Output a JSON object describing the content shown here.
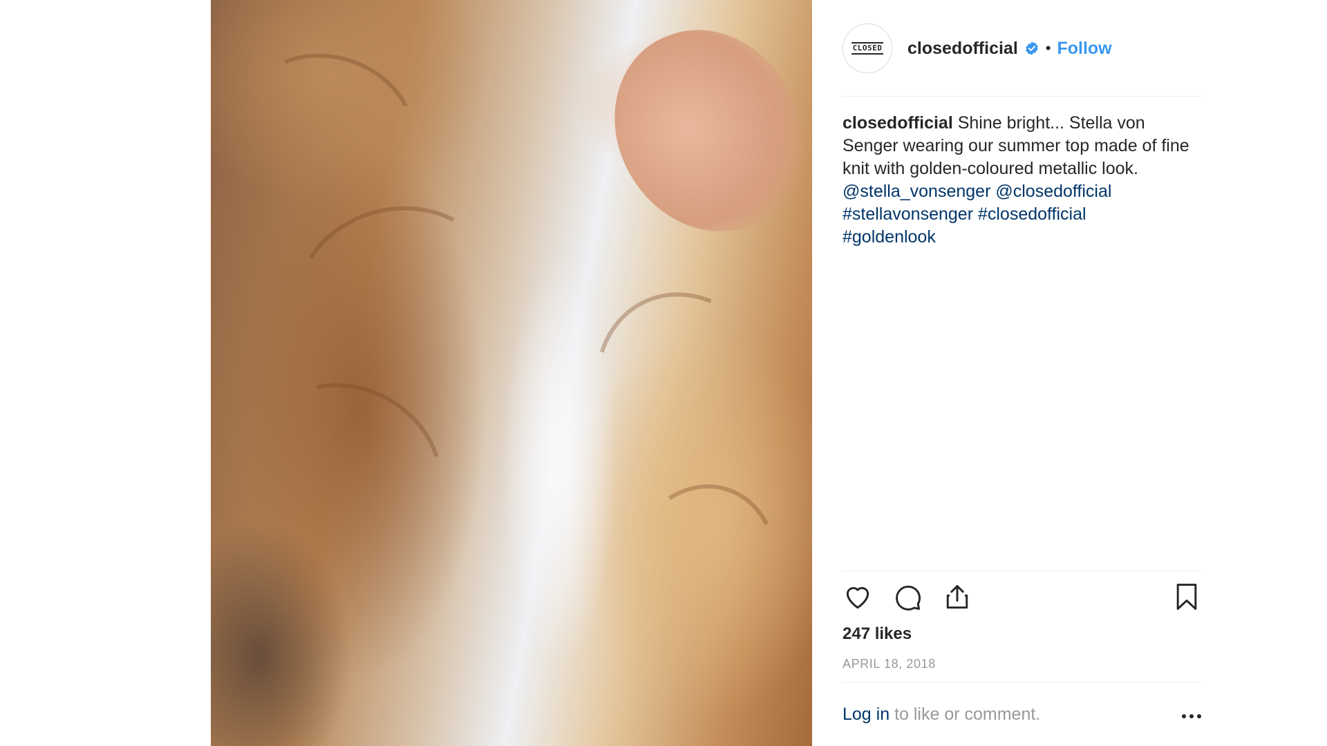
{
  "post": {
    "username": "closedofficial",
    "avatar_text": "CLOSED",
    "follow_label": "Follow",
    "separator": "•",
    "caption": {
      "username": "closedofficial",
      "text": " Shine bright... Stella von Senger wearing our summer top made of fine knit with golden-coloured metallic look.",
      "mentions": [
        "@stella_vonsenger",
        "@closedofficial"
      ],
      "hashtags": [
        "#stellavonsenger",
        "#closedofficial",
        "#goldenlook"
      ]
    },
    "likes": "247 likes",
    "date": "APRIL 18, 2018",
    "login": {
      "link_label": "Log in",
      "text": " to like or comment."
    }
  },
  "icons": {
    "verified": "verified-badge-icon",
    "like": "heart-icon",
    "comment": "comment-bubble-icon",
    "share": "share-icon",
    "save": "bookmark-icon",
    "more": "more-options-icon"
  },
  "colors": {
    "link_blue": "#3897f0",
    "mention_blue": "#003569",
    "text": "#262626",
    "muted": "#999999"
  }
}
